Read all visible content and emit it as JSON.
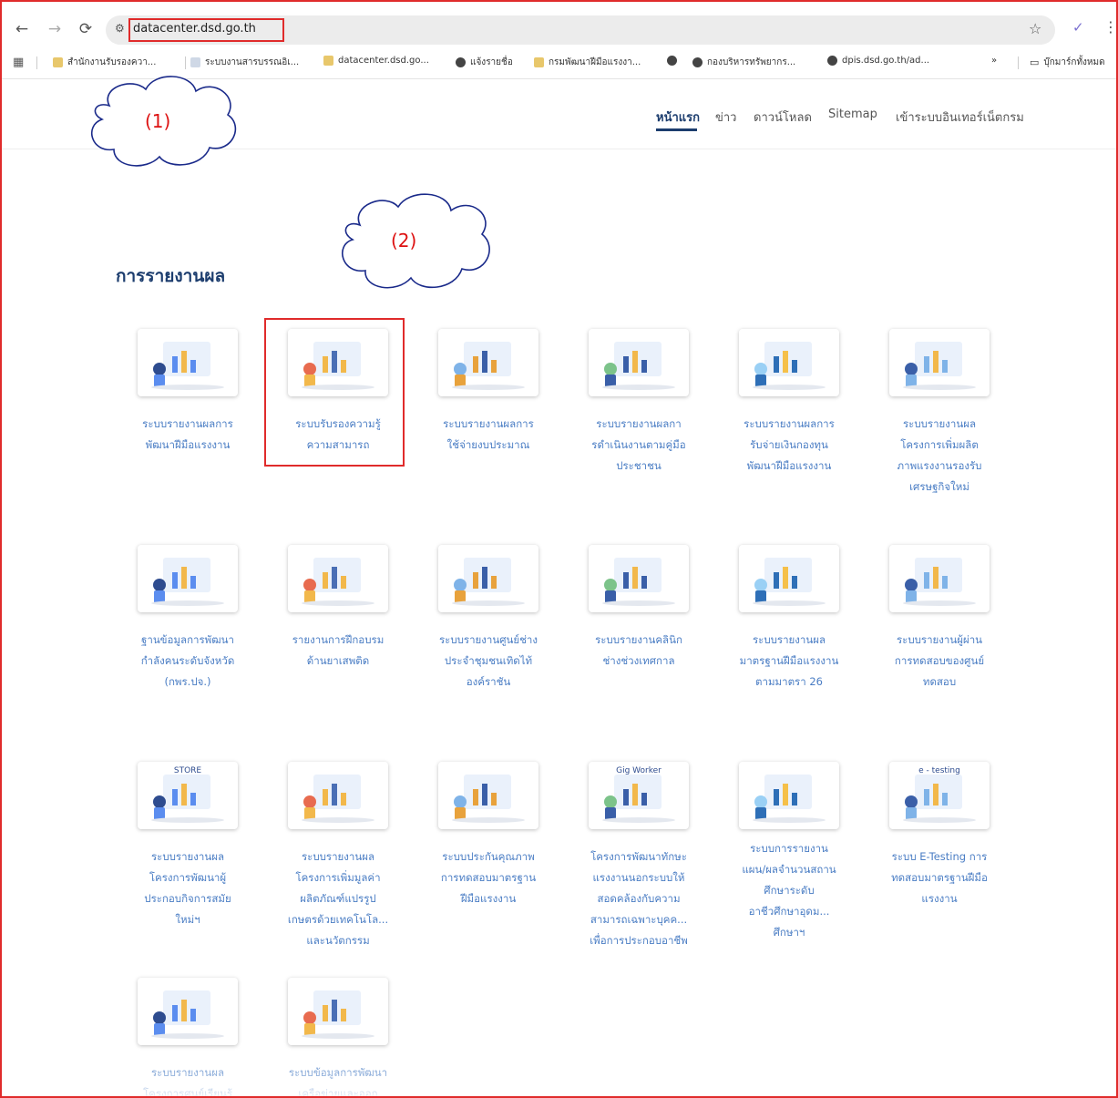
{
  "browser": {
    "url": "datacenter.dsd.go.th",
    "bookmarks": [
      {
        "label": "สำนักงานรับรองควา...",
        "icon": "seal-favicon"
      },
      {
        "label": "ระบบงานสารบรรณอิเ...",
        "icon": "doc-favicon"
      },
      {
        "label": "datacenter.dsd.go...",
        "icon": "seal-favicon"
      },
      {
        "label": "แจ้งรายชื่อ",
        "icon": "globe-favicon"
      },
      {
        "label": "กรมพัฒนาฝีมือแรงงา...",
        "icon": "seal-favicon"
      },
      {
        "label": "",
        "icon": "globe-favicon"
      },
      {
        "label": "กองบริหารทรัพยากร...",
        "icon": "globe-favicon"
      },
      {
        "label": "dpis.dsd.go.th/ad...",
        "icon": "globe-favicon"
      }
    ],
    "more_label": "»",
    "all_bookmarks_label": "บุ๊กมาร์กทั้งหมด"
  },
  "site_nav": {
    "home": "หน้าแรก",
    "news": "ข่าว",
    "download": "ดาวน์โหลด",
    "sitemap": "Sitemap",
    "login": "เข้าระบบอินเทอร์เน็ตกรม"
  },
  "annotations": {
    "one": "(1)",
    "two": "(2)"
  },
  "section_title": "การรายงานผล",
  "cards": [
    {
      "lines": [
        "ระบบรายงานผลการ",
        "พัฒนาฝีมือแรงงาน"
      ]
    },
    {
      "lines": [
        "ระบบรับรองความรู้",
        "ความสามารถ"
      ]
    },
    {
      "lines": [
        "ระบบรายงานผลการ",
        "ใช้จ่ายงบประมาณ"
      ]
    },
    {
      "lines": [
        "ระบบรายงานผลกา",
        "รดำเนินงานตามคู่มือ",
        "ประชาชน"
      ]
    },
    {
      "lines": [
        "ระบบรายงานผลการ",
        "รับจ่ายเงินกองทุน",
        "พัฒนาฝีมือแรงงาน"
      ]
    },
    {
      "lines": [
        "ระบบรายงานผล",
        "โครงการเพิ่มผลิต",
        "ภาพแรงงานรองรับ",
        "เศรษฐกิจใหม่"
      ]
    },
    {
      "lines": [
        "ฐานข้อมูลการพัฒนา",
        "กำลังคนระดับจังหวัด",
        "(กพร.ปจ.)"
      ]
    },
    {
      "lines": [
        "รายงานการฝึกอบรม",
        "ด้านยาเสพติด"
      ]
    },
    {
      "lines": [
        "ระบบรายงานศูนย์ช่าง",
        "ประจำชุมชนเทิดไท้",
        "องค์ราชัน"
      ]
    },
    {
      "lines": [
        "ระบบรายงานคลินิก",
        "ช่างช่วงเทศกาล"
      ]
    },
    {
      "lines": [
        "ระบบรายงานผล",
        "มาตรฐานฝีมือแรงงาน",
        "ตามมาตรา 26"
      ]
    },
    {
      "lines": [
        "ระบบรายงานผู้ผ่าน",
        "การทดสอบของศูนย์",
        "ทดสอบ"
      ]
    },
    {
      "lines": [
        "ระบบรายงานผล",
        "โครงการพัฒนาผู้",
        "ประกอบกิจการสมัย",
        "ใหม่ฯ"
      ],
      "thumb_text": "STORE"
    },
    {
      "lines": [
        "ระบบรายงานผล",
        "โครงการเพิ่มมูลค่า",
        "ผลิตภัณฑ์แปรรูป",
        "เกษตรด้วยเทคโนโล...",
        "และนวัตกรรม"
      ]
    },
    {
      "lines": [
        "ระบบประกันคุณภาพ",
        "การทดสอบมาตรฐาน",
        "ฝีมือแรงงาน"
      ]
    },
    {
      "lines": [
        "โครงการพัฒนาทักษะ",
        "แรงงานนอกระบบให้",
        "สอดคล้องกับความ",
        "สามารถเฉพาะบุคค...",
        "เพื่อการประกอบอาชีพ"
      ],
      "thumb_text": "Gig Worker"
    },
    {
      "lines": [
        "ระบบการรายงาน",
        "แผน/ผลจำนวนสถาน",
        "ศึกษาระดับ",
        "อาชีวศึกษาอุดม...",
        "ศึกษาฯ"
      ]
    },
    {
      "lines": [
        "ระบบ E-Testing การ",
        "ทดสอบมาตรฐานฝีมือ",
        "แรงงาน"
      ],
      "thumb_text": "e - testing"
    },
    {
      "lines": [
        "ระบบรายงานผล",
        "โครงการศูนย์เรียนรู้"
      ]
    },
    {
      "lines": [
        "ระบบข้อมูลการพัฒนา",
        "เครือข่ายและออก"
      ]
    }
  ]
}
